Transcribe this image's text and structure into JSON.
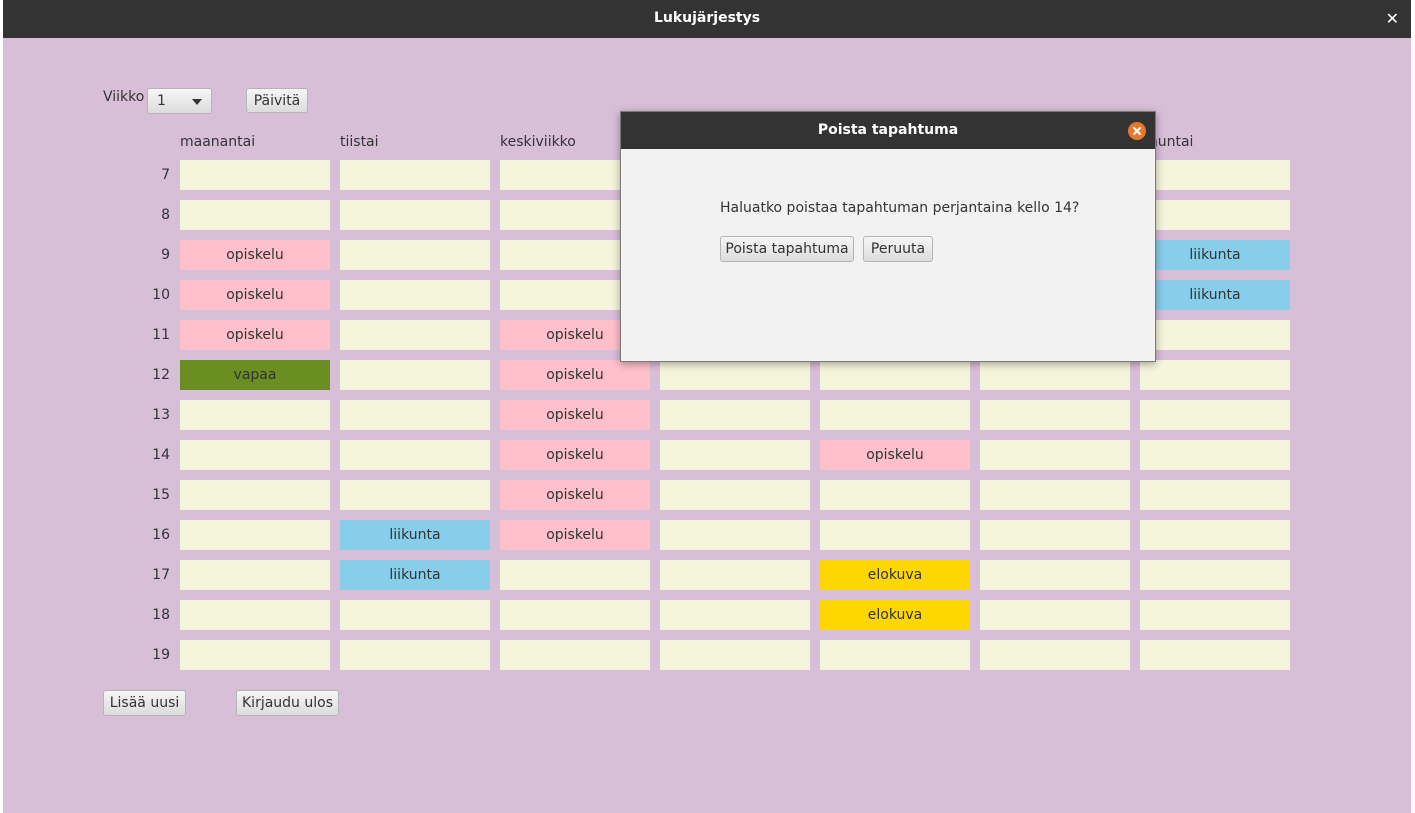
{
  "window": {
    "title": "Lukujärjestys",
    "close_glyph": "✕"
  },
  "controls": {
    "week_label": "Viikko",
    "week_value": "1",
    "update_button": "Päivitä",
    "add_button": "Lisää uusi",
    "logout_button": "Kirjaudu ulos"
  },
  "schedule": {
    "days": [
      "maanantai",
      "tiistai",
      "keskiviikko",
      "",
      "",
      "",
      "nnuntai"
    ],
    "hours": [
      "7",
      "8",
      "9",
      "10",
      "11",
      "12",
      "13",
      "14",
      "15",
      "16",
      "17",
      "18",
      "19"
    ],
    "rows": [
      [
        "",
        "",
        "",
        "",
        "",
        "",
        ""
      ],
      [
        "",
        "",
        "",
        "",
        "",
        "",
        ""
      ],
      [
        "opiskelu",
        "",
        "",
        "",
        "",
        "",
        "liikunta"
      ],
      [
        "opiskelu",
        "",
        "",
        "",
        "",
        "",
        "liikunta"
      ],
      [
        "opiskelu",
        "",
        "opiskelu",
        "",
        "",
        "",
        ""
      ],
      [
        "vapaa",
        "",
        "opiskelu",
        "",
        "",
        "",
        ""
      ],
      [
        "",
        "",
        "opiskelu",
        "",
        "",
        "",
        ""
      ],
      [
        "",
        "",
        "opiskelu",
        "",
        "opiskelu",
        "",
        ""
      ],
      [
        "",
        "",
        "opiskelu",
        "",
        "",
        "",
        ""
      ],
      [
        "",
        "liikunta",
        "opiskelu",
        "",
        "",
        "",
        ""
      ],
      [
        "",
        "liikunta",
        "",
        "",
        "elokuva",
        "",
        ""
      ],
      [
        "",
        "",
        "",
        "",
        "elokuva",
        "",
        ""
      ],
      [
        "",
        "",
        "",
        "",
        "",
        "",
        ""
      ]
    ],
    "colors": {
      "empty": "#f5f5dc",
      "opiskelu": "#ffc0cb",
      "liikunta": "#87ceeb",
      "vapaa": "#6b8e23",
      "elokuva": "#ffd700"
    }
  },
  "dialog": {
    "title": "Poista tapahtuma",
    "message": "Haluatko poistaa tapahtuman perjantaina kello 14?",
    "confirm_button": "Poista tapahtuma",
    "cancel_button": "Peruuta",
    "close_icon": "close-icon",
    "close_color": "#e8772e"
  }
}
